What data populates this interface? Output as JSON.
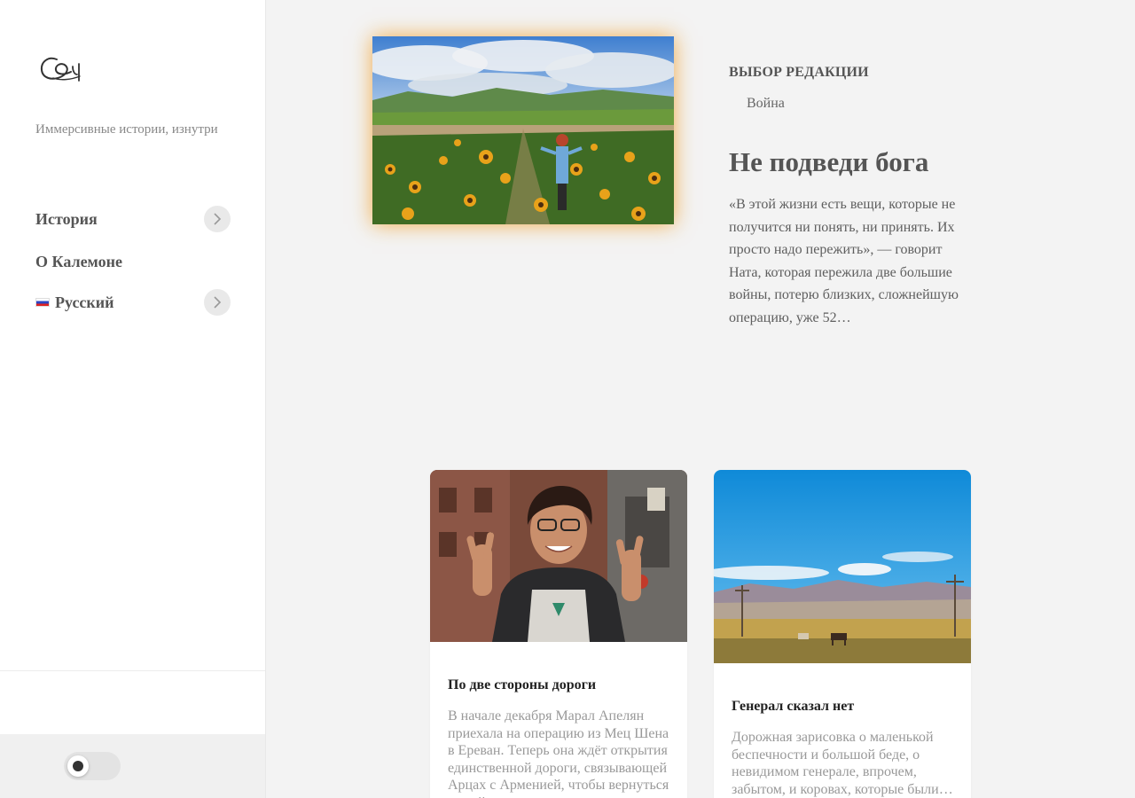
{
  "sidebar": {
    "tagline": "Иммерсивные истории, изнутри",
    "nav": [
      {
        "label": "История",
        "has_submenu": true,
        "icon": "chevron-right-icon"
      },
      {
        "label": "О Калемоне",
        "has_submenu": false
      },
      {
        "label": "Русский",
        "has_submenu": true,
        "icon": "chevron-right-icon",
        "flag": "ru-flag-icon"
      }
    ],
    "theme_toggle": {
      "state": "off"
    }
  },
  "featured": {
    "kicker": "ВЫБОР РЕДАКЦИИ",
    "category": "Война",
    "title": "Не подведи бога",
    "excerpt": "«В этой жизни есть вещи, которые не получится ни понять, ни принять. Их просто надо пережить», — говорит Ната, которая пережила две большие войны, потерю близких, сложнейшую операцию, уже 52…",
    "image_alt": "sunflower-field-photo"
  },
  "cards": [
    {
      "title": "По две стороны дороги",
      "excerpt": "В начале декабря Марал Апелян приехала на операцию из Мец Шена в Ереван. Теперь она ждёт открытия единственной дороги, связывающей Арцах с Арменией, чтобы вернуться домой…",
      "image_alt": "girl-peace-sign-photo"
    },
    {
      "title": "Генерал сказал нет",
      "excerpt": "Дорожная зарисовка о маленькой беспечности и большой беде, о невидимом генерале, впрочем, забытом, и коровах, которые были…",
      "image_alt": "landscape-horses-photo"
    }
  ],
  "colors": {
    "accent_glow": "#f0961e",
    "background": "#f3f3f3",
    "sidebar_bg": "#ffffff"
  }
}
